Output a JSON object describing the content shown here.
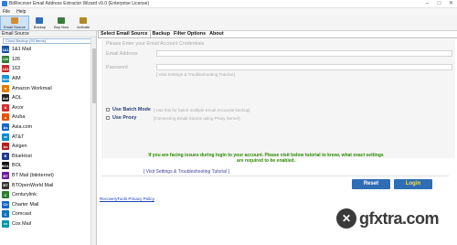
{
  "window": {
    "title": "BitRecover Email Address Extractor Wizard v9.0 (Enterprise License)"
  },
  "menu": {
    "items": [
      "File",
      "Help"
    ]
  },
  "toolbar": {
    "buttons": [
      {
        "label": "Email Source",
        "icon": "email-source-icon",
        "color": "#d88b2a"
      },
      {
        "label": "Backup",
        "icon": "backup-icon",
        "color": "#2f6db5"
      },
      {
        "label": "Buy Now",
        "icon": "cart-icon",
        "color": "#3b7a3b"
      },
      {
        "label": "Activate",
        "icon": "key-icon",
        "color": "#b08a2a"
      }
    ]
  },
  "left_panel": {
    "header": "Email Source",
    "search_value": "Cloud Backup (93 Items)",
    "providers": [
      {
        "name": "1&1 Mail",
        "abbr": "1&1",
        "color": "#1b4fa0"
      },
      {
        "name": "126",
        "abbr": "126",
        "color": "#2e7d32"
      },
      {
        "name": "163",
        "abbr": "163",
        "color": "#c62828"
      },
      {
        "name": "AIM",
        "abbr": "Aim",
        "color": "#1a8fd8"
      },
      {
        "name": "Amazon Workmail",
        "abbr": "a",
        "color": "#e07b00"
      },
      {
        "name": "AOL",
        "abbr": "Aol",
        "color": "#222222"
      },
      {
        "name": "Arcor",
        "abbr": "A",
        "color": "#d32f2f"
      },
      {
        "name": "Aruba",
        "abbr": "a",
        "color": "#e65100"
      },
      {
        "name": "Asia.com",
        "abbr": "As",
        "color": "#1565c0"
      },
      {
        "name": "AT&T",
        "abbr": "at",
        "color": "#0288d1"
      },
      {
        "name": "Axigen",
        "abbr": "Ax",
        "color": "#b71c1c"
      },
      {
        "name": "BlueHost",
        "abbr": "B",
        "color": "#1e3a8a"
      },
      {
        "name": "BOL",
        "abbr": "BOL",
        "color": "#111111"
      },
      {
        "name": "BT Mail (btinternet)",
        "abbr": "BT",
        "color": "#6a1b9a"
      },
      {
        "name": "BTOpenWorld Mail",
        "abbr": "BT",
        "color": "#333333"
      },
      {
        "name": "Centurylink",
        "abbr": "C",
        "color": "#2e7d32"
      },
      {
        "name": "Charter Mail",
        "abbr": "Ch",
        "color": "#1565c0"
      },
      {
        "name": "Comcast",
        "abbr": "C",
        "color": "#0b6fbf"
      },
      {
        "name": "Cox Mail",
        "abbr": "cx",
        "color": "#0097a7"
      }
    ]
  },
  "tabs": [
    "Select Email Source",
    "Backup",
    "Filter Options",
    "About"
  ],
  "form": {
    "heading": "Please Enter your Email Account Credentials",
    "email_label": "Email Address",
    "password_label": "Password",
    "settings_hint": "[ Visit Settings & Troubleshooting Tutorial ]",
    "batch_label": "Use Batch Mode",
    "batch_hint": "[ Use this for batch multiple Email Accounts backup]",
    "proxy_label": "Use Proxy",
    "proxy_hint": "[Connecting Email Source using Proxy Server]"
  },
  "notice": "If you are facing issues during login to your account. Please visit below tutorial to know, what exact settings are required to be enabled.",
  "tutorial_link": "[ Visit Settings & Troubleshooting Tutorial ]",
  "buttons": {
    "reset": "Reset",
    "login": "Login"
  },
  "privacy_link": "RecoveryTools Privacy Policy",
  "watermark": {
    "text": "gfxtra.com"
  },
  "colors": {
    "accent": "#2f6db5",
    "notice": "#2b8a00",
    "login_text": "#f4e04d"
  }
}
